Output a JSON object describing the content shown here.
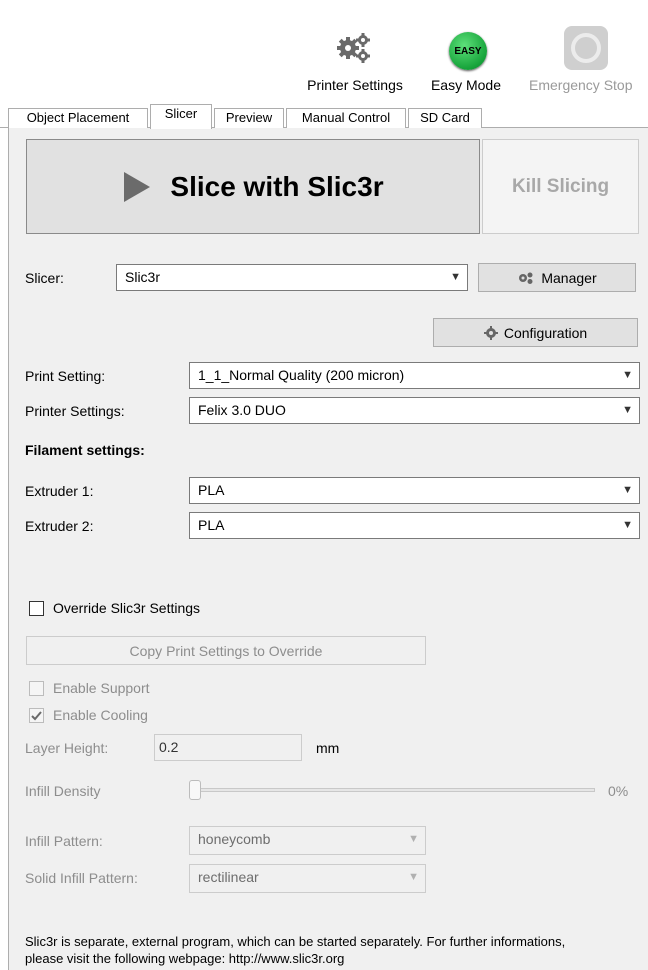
{
  "toolbar": {
    "printer_settings": "Printer Settings",
    "easy_mode": "Easy Mode",
    "easy_badge": "EASY",
    "emergency_stop": "Emergency Stop"
  },
  "tabs": [
    "Object Placement",
    "Slicer",
    "Preview",
    "Manual Control",
    "SD Card"
  ],
  "slicer": {
    "slice_button": "Slice with Slic3r",
    "kill_button": "Kill Slicing",
    "slicer_label": "Slicer:",
    "slicer_value": "Slic3r",
    "manager_button": "Manager",
    "configuration_button": "Configuration",
    "print_setting_label": "Print Setting:",
    "print_setting_value": "1_1_Normal Quality (200 micron)",
    "printer_settings_label": "Printer Settings:",
    "printer_settings_value": "Felix 3.0 DUO",
    "filament_header": "Filament settings:",
    "extruder1_label": "Extruder 1:",
    "extruder1_value": "PLA",
    "extruder2_label": "Extruder 2:",
    "extruder2_value": "PLA",
    "override_label": "Override Slic3r Settings",
    "copy_button": "Copy Print Settings to Override",
    "enable_support": "Enable Support",
    "enable_cooling": "Enable Cooling",
    "layer_height_label": "Layer Height:",
    "layer_height_value": "0.2",
    "layer_height_unit": "mm",
    "infill_density_label": "Infill Density",
    "infill_density_value": "0%",
    "infill_density_level": 0,
    "infill_pattern_label": "Infill Pattern:",
    "infill_pattern_value": "honeycomb",
    "solid_infill_label": "Solid Infill Pattern:",
    "solid_infill_value": "rectilinear",
    "footer_text": "Slic3r is separate, external program, which can be started separately. For further informations, please visit the following webpage: http://www.slic3r.org"
  },
  "colors": {
    "easy_green": "#22b14c",
    "play_arrow": "#6b6b6b",
    "disabled_text": "#9a9a9a"
  },
  "icons": [
    "gears-icon",
    "easy-mode-icon",
    "emergency-stop-icon",
    "play-icon",
    "gear-icon"
  ]
}
